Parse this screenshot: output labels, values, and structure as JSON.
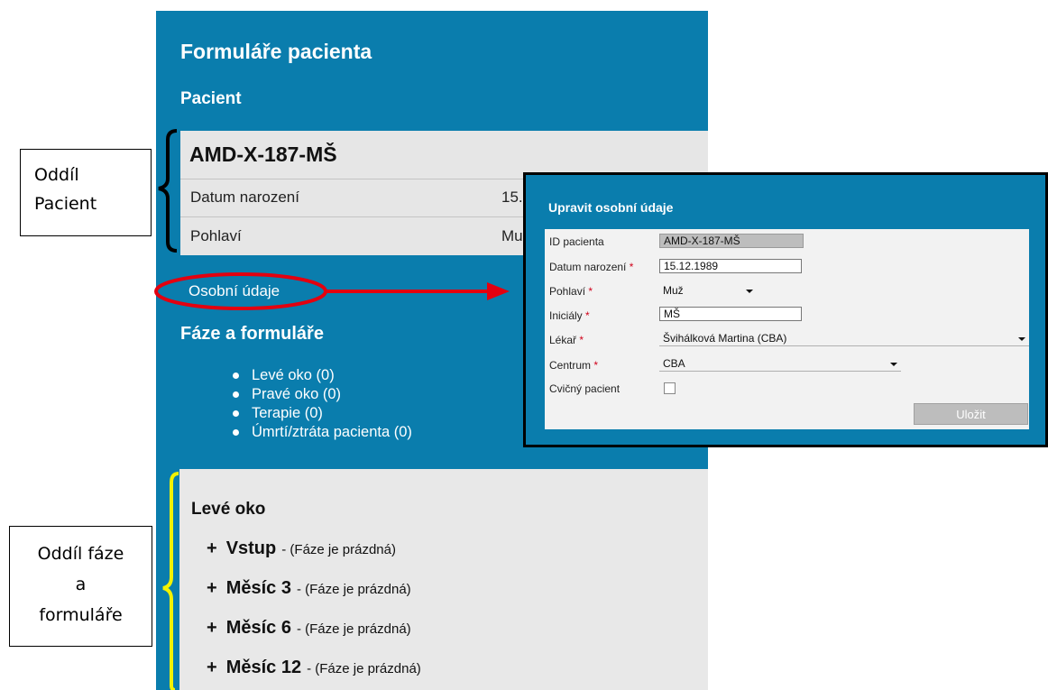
{
  "panel": {
    "title": "Formuláře pacienta",
    "pacient_heading": "Pacient",
    "patient_id": "AMD-X-187-MŠ",
    "rows": [
      {
        "label": "Datum narození",
        "value": "15."
      },
      {
        "label": "Pohlaví",
        "value": "Mu"
      }
    ],
    "osobni_link": "Osobní údaje",
    "faze_heading": "Fáze a formuláře",
    "phases": [
      "Levé oko (0)",
      "Pravé oko (0)",
      "Terapie (0)",
      "Úmrtí/ztráta pacienta (0)"
    ]
  },
  "eye_section": {
    "title": "Levé oko",
    "visits": [
      {
        "plus": "+",
        "name": "Vstup",
        "status": "- (Fáze je prázdná)"
      },
      {
        "plus": "+",
        "name": "Měsíc 3",
        "status": "- (Fáze je prázdná)"
      },
      {
        "plus": "+",
        "name": "Měsíc 6",
        "status": "- (Fáze je prázdná)"
      },
      {
        "plus": "+",
        "name": "Měsíc 12",
        "status": "- (Fáze je prázdná)"
      }
    ]
  },
  "annotations": {
    "pacient": [
      "Oddíl",
      "Pacient"
    ],
    "faze": [
      "Oddíl fáze",
      "a",
      "formuláře"
    ]
  },
  "dialog": {
    "title": "Upravit osobní údaje",
    "fields": [
      {
        "label": "ID pacienta",
        "required": "",
        "value": "AMD-X-187-MŠ"
      },
      {
        "label": "Datum narození",
        "required": "*",
        "value": "15.12.1989"
      },
      {
        "label": "Pohlaví",
        "required": "*",
        "value": "Muž"
      },
      {
        "label": "Iniciály",
        "required": "*",
        "value": "MŠ"
      },
      {
        "label": "Lékař",
        "required": "*",
        "value": "Švihálková Martina (CBA)"
      },
      {
        "label": "Centrum",
        "required": "*",
        "value": "CBA"
      },
      {
        "label": "Cvičný pacient",
        "required": "",
        "value": ""
      }
    ],
    "save_label": "Uložit"
  },
  "colors": {
    "panel_blue": "#0a7dad",
    "highlight_red": "#e3000f",
    "bracket_black": "#000000",
    "bracket_yellow": "#f2f200",
    "required_red": "#d0021b"
  }
}
